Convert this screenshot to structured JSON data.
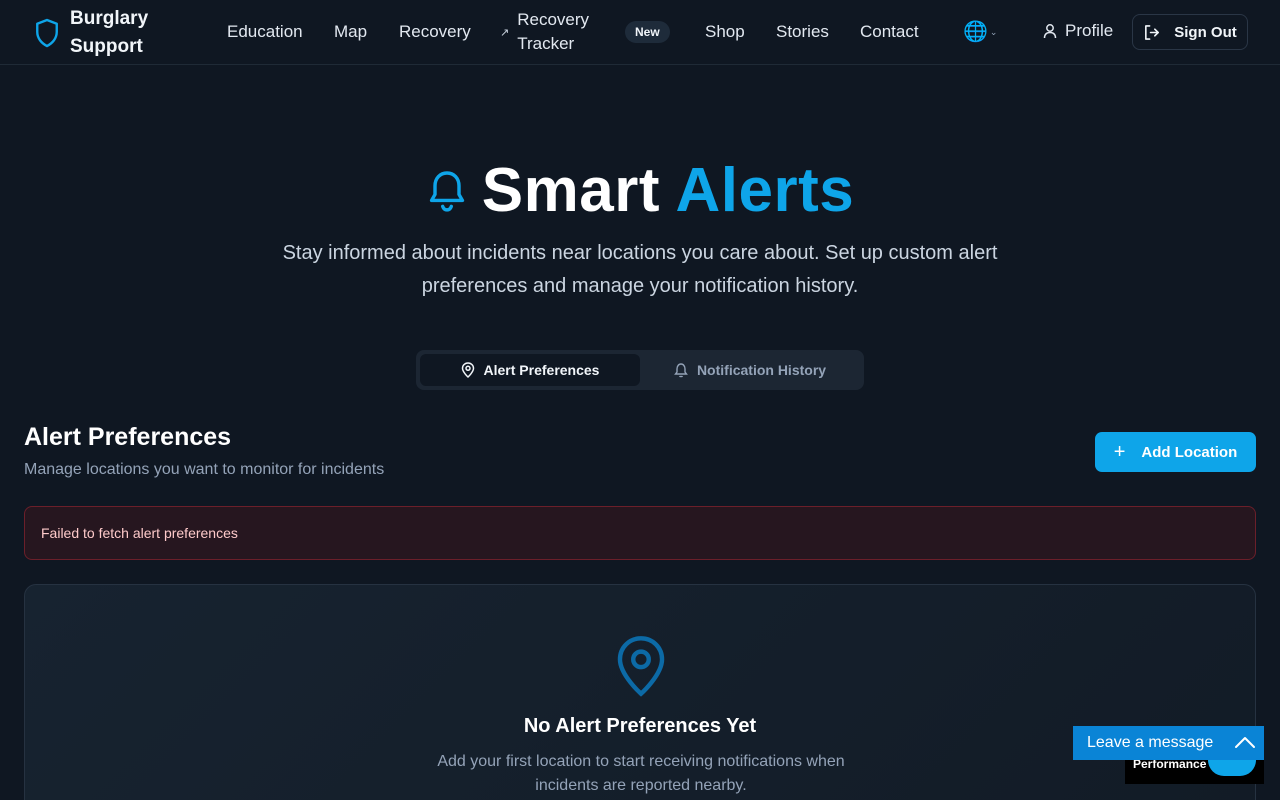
{
  "nav": {
    "brand": "Burglary Support",
    "links": [
      "Education",
      "Map",
      "Recovery"
    ],
    "tracker_label": "Recovery Tracker",
    "new_badge": "New",
    "links2": [
      "Shop",
      "Stories",
      "Contact"
    ],
    "profile": "Profile",
    "signout": "Sign Out"
  },
  "hero": {
    "title_a": "Smart",
    "title_b": "Alerts",
    "subtitle": "Stay informed about incidents near locations you care about. Set up custom alert preferences and manage your notification history."
  },
  "tabs": {
    "preferences": "Alert Preferences",
    "history": "Notification History"
  },
  "section": {
    "title": "Alert Preferences",
    "subtitle": "Manage locations you want to monitor for incidents",
    "add_button": "Add Location"
  },
  "error": "Failed to fetch alert preferences",
  "empty": {
    "title": "No Alert Preferences Yet",
    "subtitle": "Add your first location to start receiving notifications when incidents are reported nearby."
  },
  "widgets": {
    "performance": "Performance",
    "leave_message": "Leave a message"
  },
  "colors": {
    "accent": "#0ea5e9",
    "background": "#0f1722",
    "error_text": "#fecaca"
  }
}
